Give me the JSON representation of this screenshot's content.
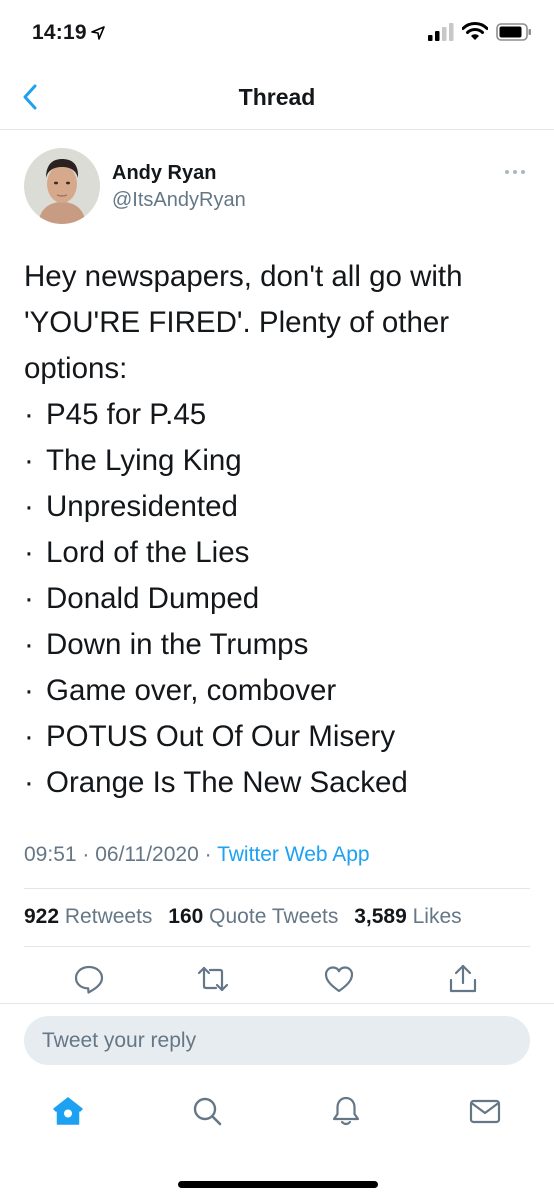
{
  "status_bar": {
    "time": "14:19"
  },
  "nav": {
    "title": "Thread"
  },
  "tweet": {
    "author_name": "Andy Ryan",
    "author_handle": "@ItsAndyRyan",
    "intro": "Hey newspapers, don't all go with 'YOU'RE FIRED'. Plenty of other options:",
    "bullets": [
      "P45 for P.45",
      "The Lying King",
      "Unpresidented",
      "Lord of the Lies",
      "Donald Dumped",
      "Down in the Trumps",
      "Game over, combover",
      "POTUS Out Of Our Misery",
      "Orange Is The New Sacked"
    ],
    "time": "09:51",
    "date": "06/11/2020",
    "source": "Twitter Web App"
  },
  "stats": {
    "retweets_count": "922",
    "retweets_label": "Retweets",
    "quotes_count": "160",
    "quotes_label": "Quote Tweets",
    "likes_count": "3,589",
    "likes_label": "Likes"
  },
  "reply": {
    "placeholder": "Tweet your reply"
  },
  "icons": {
    "back": "chevron-left-icon",
    "more": "more-horizontal-icon",
    "reply": "comment-icon",
    "retweet": "retweet-icon",
    "like": "heart-icon",
    "share": "share-icon",
    "home": "home-icon",
    "search": "search-icon",
    "notifications": "bell-icon",
    "messages": "mail-icon"
  },
  "colors": {
    "accent": "#1da1f2",
    "muted": "#657786",
    "text": "#14171a",
    "divider": "#e1e8ed"
  }
}
